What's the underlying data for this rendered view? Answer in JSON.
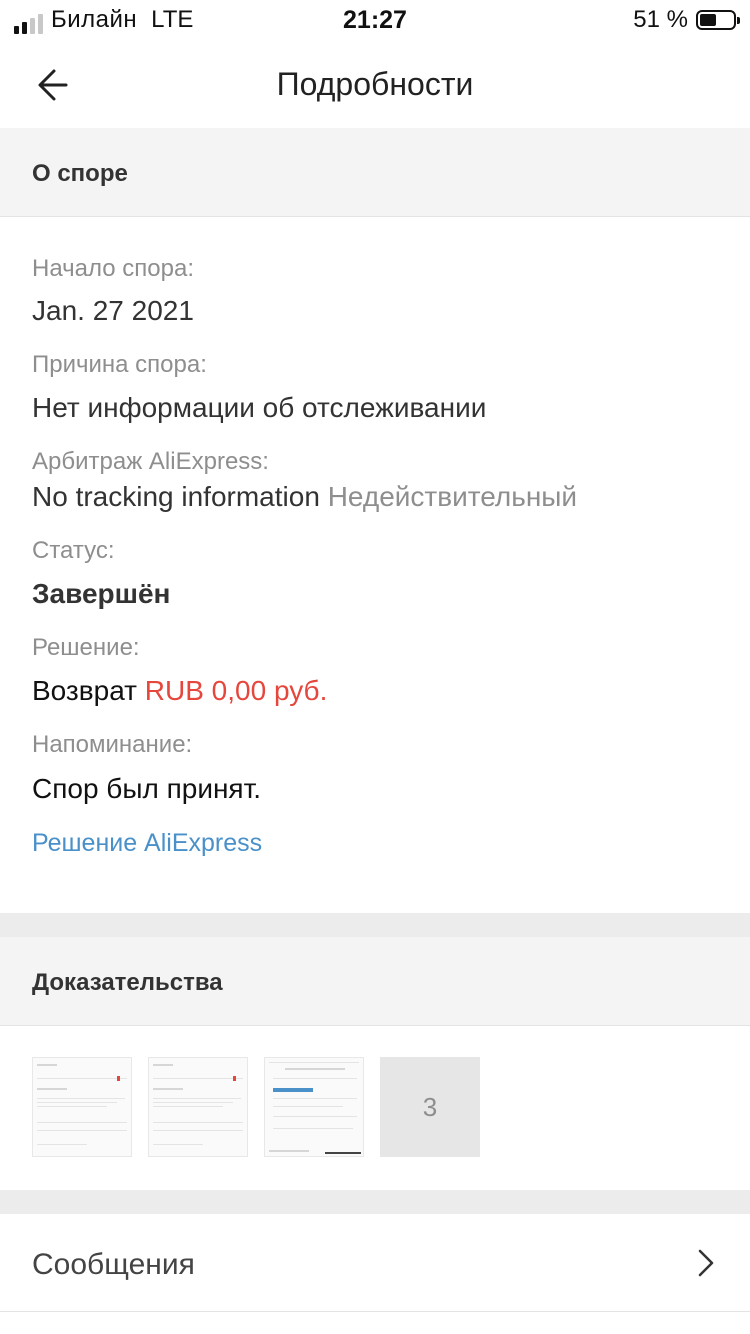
{
  "status_bar": {
    "carrier": "Билайн",
    "network": "LTE",
    "time": "21:27",
    "battery": "51 %",
    "battery_level": 0.51
  },
  "nav": {
    "title": "Подробности"
  },
  "dispute": {
    "section_title": "О споре",
    "start_label": "Начало спора:",
    "start_value": "Jan. 27 2021",
    "reason_label": "Причина спора:",
    "reason_value": "Нет информации об отслеживании",
    "arbitration_label": "Арбитраж AliExpress:",
    "arbitration_value": "No tracking information",
    "arbitration_status": "Недействительный",
    "status_label": "Статус:",
    "status_value": "Завершён",
    "solution_label": "Решение:",
    "solution_value": "Возврат",
    "solution_amount": "RUB 0,00 руб.",
    "reminder_label": "Напоминание:",
    "reminder_value": "Спор был принят.",
    "aliexpress_link": "Решение AliExpress"
  },
  "evidence": {
    "section_title": "Доказательства",
    "more_count": "3"
  },
  "messages": {
    "label": "Сообщения"
  },
  "colors": {
    "accent_red": "#e5473d",
    "link_blue": "#4a90c9"
  }
}
